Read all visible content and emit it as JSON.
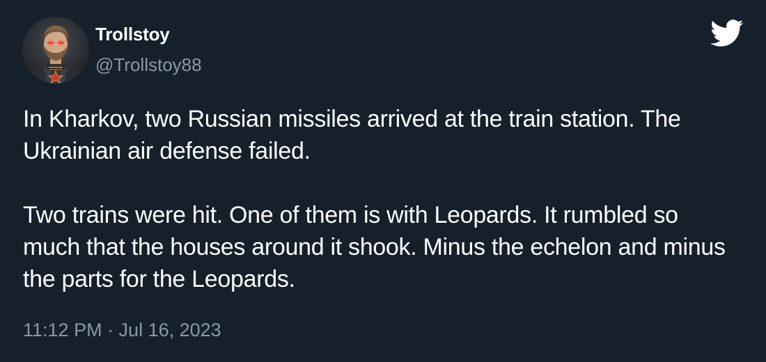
{
  "author": {
    "name": "Trollstoy",
    "handle": "@Trollstoy88",
    "avatar_icon": "profile-avatar"
  },
  "brand": {
    "icon": "twitter-bird-icon",
    "color": "#ffffff"
  },
  "tweet": {
    "paragraphs": [
      "In Kharkov, two Russian missiles arrived at the train station. The Ukrainian air defense failed.",
      "Two trains were hit. One of them is with Leopards. It rumbled so much that the houses around it shook. Minus the echelon and minus the parts for the Leopards."
    ],
    "timestamp": "11:12 PM · Jul 16, 2023"
  },
  "colors": {
    "background": "#15202b",
    "text": "#ffffff",
    "secondary_text": "#8b98a5"
  }
}
